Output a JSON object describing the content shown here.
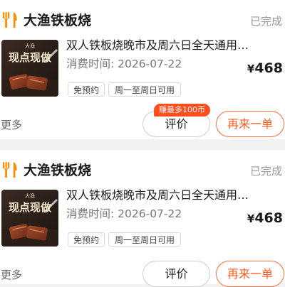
{
  "orders": [
    {
      "store_name": "大渔铁板烧",
      "status": "已完成",
      "thumbnail_text": "现点现做",
      "thumbnail_logo": "大渔",
      "deal_title": "双人铁板烧晚市及周六日全天通用套餐",
      "date_label": "消费时间: ",
      "date_value": "2026-07-22",
      "price_symbol": "¥",
      "price_value": "468",
      "tags": [
        "免预约",
        "周一至周日可用"
      ],
      "more_label": "更多",
      "review_label": "评价",
      "reorder_label": "再来一单",
      "earn_badge": "赚最多100币"
    },
    {
      "store_name": "大渔铁板烧",
      "status": "已完成",
      "thumbnail_text": "现点现做",
      "thumbnail_logo": "大渔",
      "deal_title": "双人铁板烧晚市及周六日全天通用套餐",
      "date_label": "消费时间: ",
      "date_value": "2026-07-22",
      "price_symbol": "¥",
      "price_value": "468",
      "tags": [
        "免预约",
        "周一至周日可用"
      ],
      "more_label": "更多",
      "review_label": "评价",
      "reorder_label": "再来一单"
    }
  ],
  "colors": {
    "accent": "#ff5a1f",
    "badge": "#ff4d1d",
    "icon": "#ff8c00",
    "page_bg": "#f2f2f2"
  },
  "icons": {
    "store": "fork-knife-icon"
  }
}
